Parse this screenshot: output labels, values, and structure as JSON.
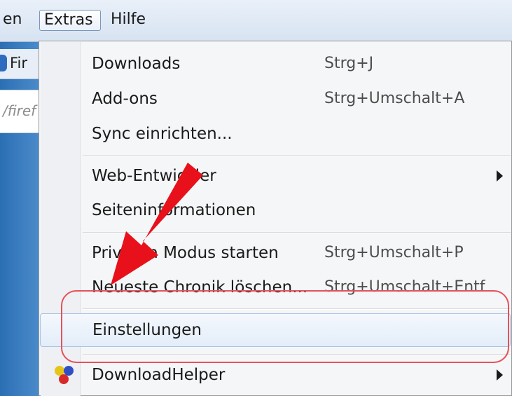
{
  "menubar": {
    "partial_item": "en",
    "active_item": "Extras",
    "next_item": "Hilfe"
  },
  "browser": {
    "tab_label": "Fir",
    "url_fragment": "/firef"
  },
  "menu": {
    "items": [
      {
        "label": "Downloads",
        "shortcut": "Strg+J"
      },
      {
        "label": "Add-ons",
        "shortcut": "Strg+Umschalt+A"
      },
      {
        "label": "Sync einrichten...",
        "shortcut": ""
      },
      {
        "label": "Web-Entwickler",
        "shortcut": "",
        "submenu": true
      },
      {
        "label": "Seiteninformationen",
        "shortcut": ""
      },
      {
        "label": "Privaten Modus starten",
        "shortcut": "Strg+Umschalt+P"
      },
      {
        "label": "Neueste Chronik löschen...",
        "shortcut": "Strg+Umschalt+Entf"
      },
      {
        "label": "Einstellungen",
        "shortcut": "",
        "highlighted": true
      },
      {
        "label": "DownloadHelper",
        "shortcut": "",
        "submenu": true,
        "icon": "downloadhelper-icon"
      }
    ]
  },
  "annotation": {
    "color": "#e8505a",
    "arrow_color": "#e8101a",
    "points_to": "Einstellungen"
  },
  "colors": {
    "menu_bg": "#f5f6f7",
    "hover_border": "#a9c3e3",
    "menubar_bg": "#d7e3f2"
  }
}
